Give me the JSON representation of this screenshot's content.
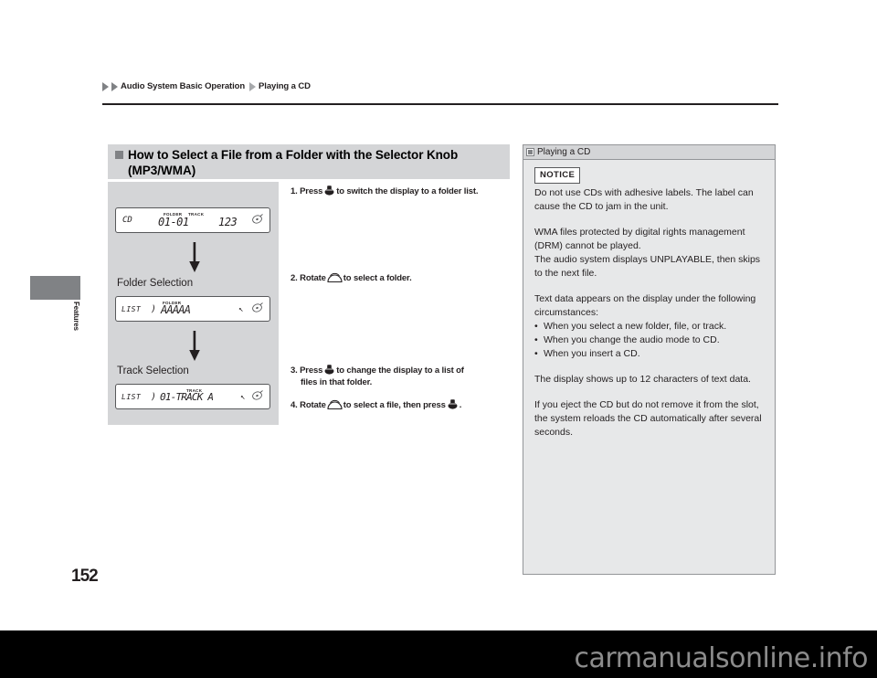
{
  "breadcrumb": {
    "parent": "Audio System Basic Operation",
    "current": "Playing a CD"
  },
  "side_tab": {
    "label": "Features"
  },
  "page_number": "152",
  "section": {
    "heading_line1": "How to Select a File from a Folder with the Selector Knob",
    "heading_line2": "(MP3/WMA)"
  },
  "illustration": {
    "display1": {
      "mode": "CD",
      "folder_label": "FOLDER",
      "track_label": "TRACK",
      "folder_track": "01-01",
      "elapsed": "123",
      "disc_icon": "disc-icon"
    },
    "caption_folder": "Folder Selection",
    "display2": {
      "list_label": "LIST",
      "separator": ")",
      "folder_label": "FOLDER",
      "value": "AAAAA",
      "enter_mark": "↖",
      "disc_icon": "disc-icon"
    },
    "caption_track": "Track Selection",
    "display3": {
      "list_label": "LIST",
      "separator": ")",
      "track_label": "TRACK",
      "value": "01-TRACK A",
      "enter_mark": "↖",
      "disc_icon": "disc-icon"
    },
    "arrow1": "down-arrow-icon",
    "arrow2": "down-arrow-icon"
  },
  "steps": [
    {
      "number": "1.",
      "before": "Press",
      "icon": "knob-press-icon",
      "after": "to switch the display to a folder list."
    },
    {
      "number": "2.",
      "before": "Rotate",
      "icon": "knob-rotate-icon",
      "after": "to select a folder."
    },
    {
      "number": "3.",
      "before": "Press",
      "icon": "knob-press-icon",
      "after": "to change the display to a list of",
      "after2": "files in that folder."
    },
    {
      "number": "4.",
      "before": "Rotate",
      "icon": "knob-rotate-icon",
      "after": "to select a file, then press",
      "icon2": "knob-press-icon",
      "after3": "."
    }
  ],
  "sidebar": {
    "title": "Playing a CD",
    "title_icon": "note-icon",
    "notice_badge": "NOTICE",
    "notice_text": "Do not use CDs with adhesive labels. The label can cause the CD to jam in the unit.",
    "para_drm": "WMA files protected by digital rights management (DRM) cannot be played.",
    "para_unplayable": "The audio system displays UNPLAYABLE, then skips to the next file.",
    "para_textdata": "Text data appears on the display under the following circumstances:",
    "bullets": [
      "When you select a new folder, file, or track.",
      "When you change the audio mode to CD.",
      "When you insert a CD."
    ],
    "para_chars": "The display shows up to 12 characters of text data.",
    "para_eject": "If you eject the CD but do not remove it from the slot, the system reloads the CD automatically after several seconds."
  },
  "watermark": {
    "text": "carmanualsonline.info"
  }
}
